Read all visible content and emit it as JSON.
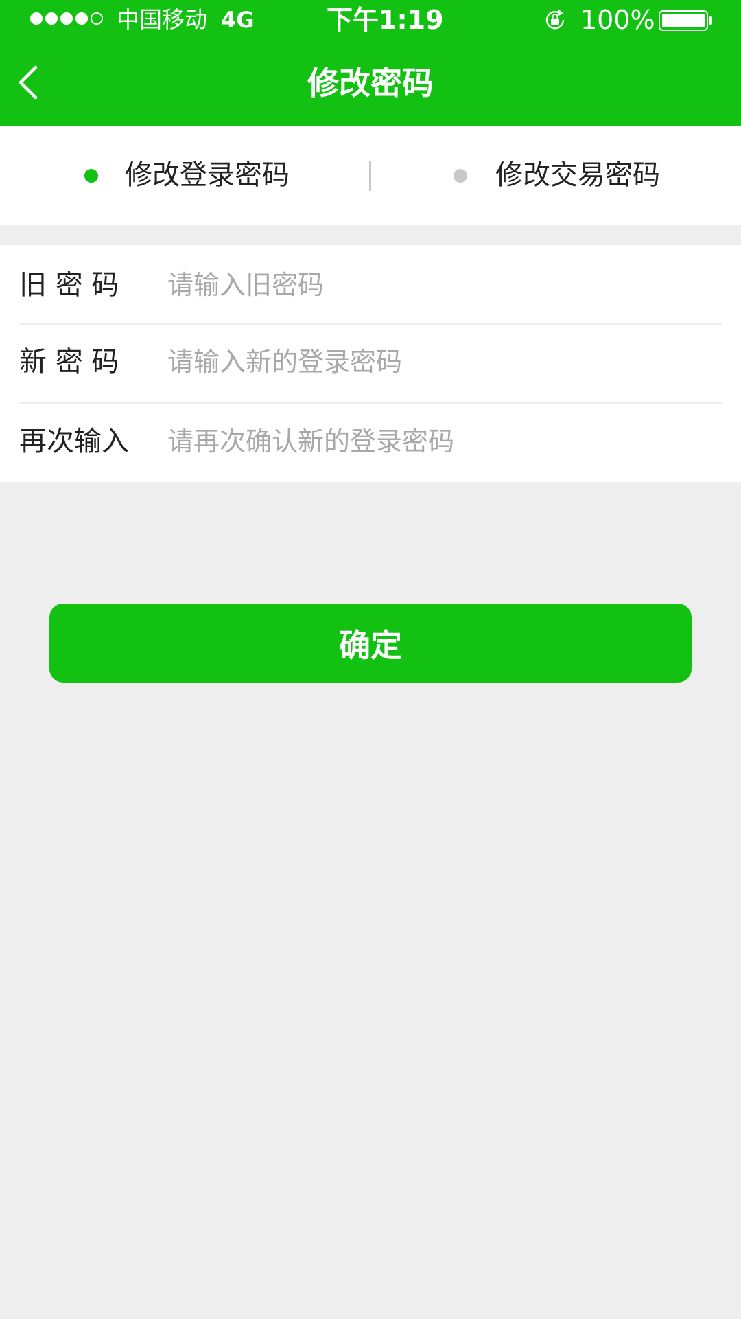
{
  "colors": {
    "brand_green": "#13c113",
    "active_dot": "#13c113",
    "inactive_dot": "#c8c8c8",
    "background": "#eeeeee",
    "placeholder": "#a8a8a8"
  },
  "status_bar": {
    "carrier": "中国移动",
    "network": "4G",
    "time": "下午1:19",
    "battery": "100%",
    "signal_bars_filled": 4,
    "signal_bars_total": 5,
    "icons": [
      "signal-dots-icon",
      "rotation-lock-icon",
      "battery-icon"
    ]
  },
  "header": {
    "back_icon": "chevron-left-icon",
    "title": "修改密码"
  },
  "tabs": [
    {
      "label": "修改登录密码",
      "active": true
    },
    {
      "label": "修改交易密码",
      "active": false
    }
  ],
  "form": {
    "old_password": {
      "label": "旧 密 码",
      "placeholder": "请输入旧密码",
      "value": ""
    },
    "new_password": {
      "label": "新 密 码",
      "placeholder": "请输入新的登录密码",
      "value": ""
    },
    "confirm_password": {
      "label": "再次输入",
      "placeholder": "请再次确认新的登录密码",
      "value": ""
    }
  },
  "confirm_button": {
    "label": "确定"
  }
}
